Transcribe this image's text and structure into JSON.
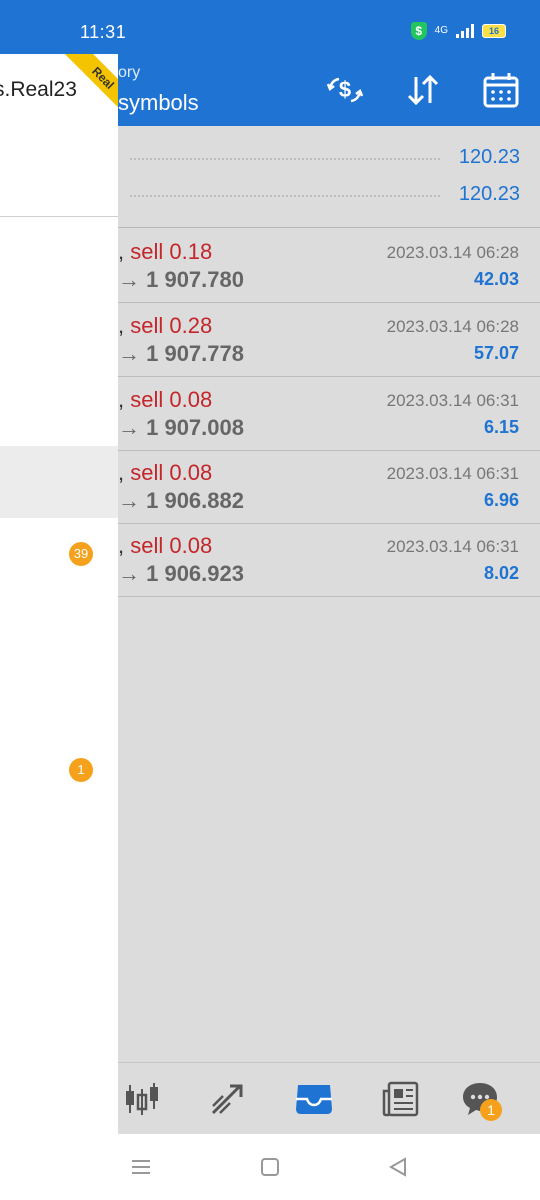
{
  "status": {
    "time": "11:31",
    "network": "4G",
    "battery": "16"
  },
  "header": {
    "subtitle": "ory",
    "title": "symbols"
  },
  "toolbar": {
    "icons": [
      "currency-exchange-icon",
      "sort-icon",
      "calendar-icon"
    ]
  },
  "summary": [
    {
      "value": "120.23"
    },
    {
      "value": "120.23"
    }
  ],
  "trades": [
    {
      "prefix": ",",
      "action": "sell 0.18",
      "price": "→ 1 907.780",
      "timestamp": "2023.03.14 06:28",
      "profit": "42.03"
    },
    {
      "prefix": ",",
      "action": "sell 0.28",
      "price": "→ 1 907.778",
      "timestamp": "2023.03.14 06:28",
      "profit": "57.07"
    },
    {
      "prefix": ",",
      "action": "sell 0.08",
      "price": "→ 1 907.008",
      "timestamp": "2023.03.14 06:31",
      "profit": "6.15"
    },
    {
      "prefix": ",",
      "action": "sell 0.08",
      "price": "→ 1 906.882",
      "timestamp": "2023.03.14 06:31",
      "profit": "6.96"
    },
    {
      "prefix": ",",
      "action": "sell 0.08",
      "price": "→ 1 906.923",
      "timestamp": "2023.03.14 06:31",
      "profit": "8.02"
    }
  ],
  "drawer": {
    "account": "s.Real23",
    "ribbon": "Real",
    "badges": [
      "39",
      "1"
    ]
  },
  "bottom_nav": {
    "items": [
      "quotes-icon",
      "trade-icon",
      "history-icon",
      "news-icon",
      "chat-icon"
    ],
    "chat_badge": "1"
  },
  "colors": {
    "accent": "#1f73d2",
    "sell": "#c4262a",
    "badge": "#f5a11c"
  }
}
